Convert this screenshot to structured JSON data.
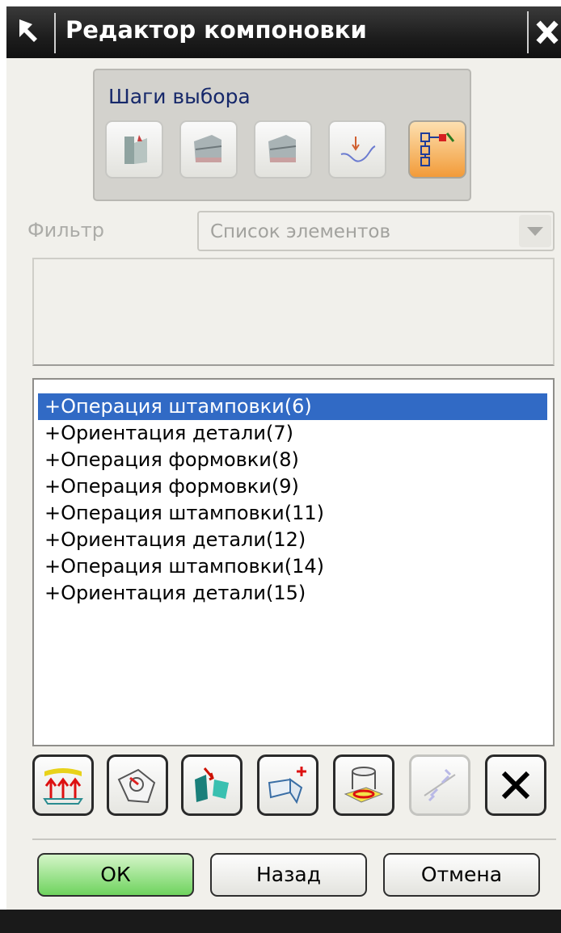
{
  "window": {
    "title": "Редактор компоновки",
    "pin_icon": "pin-arrow-icon",
    "close_icon": "close-icon"
  },
  "selection_steps": {
    "title": "Шаги выбора",
    "buttons": [
      {
        "icon": "face-select-icon",
        "active": false
      },
      {
        "icon": "die-select-icon",
        "active": false
      },
      {
        "icon": "die-select-2-icon",
        "active": false
      },
      {
        "icon": "curve-select-icon",
        "active": false
      },
      {
        "icon": "tree-list-icon",
        "active": true
      }
    ]
  },
  "filter": {
    "label": "Фильтр",
    "value": "Список элементов",
    "dropdown_icon": "chevron-down-icon"
  },
  "list": {
    "items": [
      {
        "label": "+Операция штамповки(6)",
        "selected": true
      },
      {
        "label": "+Ориентация детали(7)",
        "selected": false
      },
      {
        "label": "+Операция формовки(8)",
        "selected": false
      },
      {
        "label": "+Операция формовки(9)",
        "selected": false
      },
      {
        "label": "+Операция штамповки(11)",
        "selected": false
      },
      {
        "label": "+Ориентация детали(12)",
        "selected": false
      },
      {
        "label": "+Операция штамповки(14)",
        "selected": false
      },
      {
        "label": "+Ориентация детали(15)",
        "selected": false
      }
    ]
  },
  "toolbar": {
    "buttons": [
      {
        "icon": "stamping-operation-icon",
        "enabled": true
      },
      {
        "icon": "part-orientation-icon",
        "enabled": true
      },
      {
        "icon": "forming-operation-icon",
        "enabled": true
      },
      {
        "icon": "bending-operation-icon",
        "enabled": true
      },
      {
        "icon": "piercing-operation-icon",
        "enabled": true
      },
      {
        "icon": "reorder-icon",
        "enabled": false
      },
      {
        "icon": "delete-icon",
        "enabled": true
      }
    ]
  },
  "actions": {
    "ok": "ОК",
    "back": "Назад",
    "cancel": "Отмена"
  },
  "colors": {
    "title_bar": "#1d1d1d",
    "selection": "#316ac5",
    "ok_button": "#6fd35e",
    "active_step": "#f29b39"
  }
}
